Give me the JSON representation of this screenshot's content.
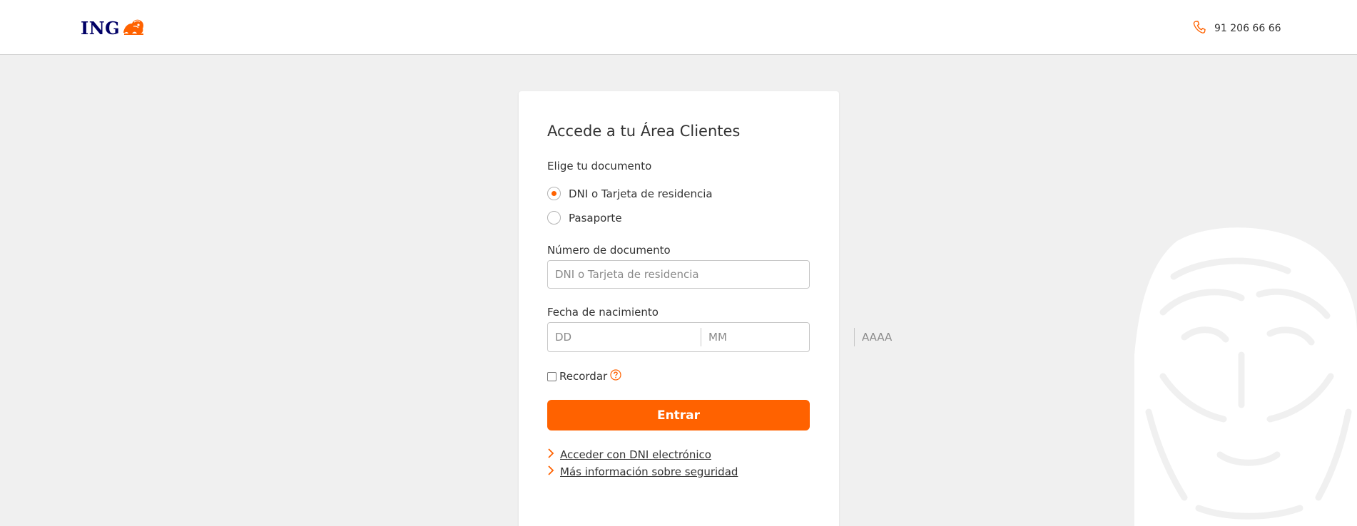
{
  "header": {
    "logo_text": "ING",
    "phone": "91 206 66 66"
  },
  "login": {
    "title": "Accede a tu Área Clientes",
    "doc_type_label": "Elige tu documento",
    "doc_options": [
      {
        "label": "DNI o Tarjeta de residencia",
        "selected": true
      },
      {
        "label": "Pasaporte",
        "selected": false
      }
    ],
    "doc_number_label": "Número de documento",
    "doc_number_placeholder": "DNI o Tarjeta de residencia",
    "birth_label": "Fecha de nacimiento",
    "day_placeholder": "DD",
    "month_placeholder": "MM",
    "year_placeholder": "AAAA",
    "remember_label": "Recordar",
    "submit_label": "Entrar",
    "links": [
      {
        "label": "Acceder con DNI electrónico"
      },
      {
        "label": "Más información sobre seguridad"
      }
    ]
  },
  "colors": {
    "brand_orange": "#ff6200",
    "brand_navy": "#000066",
    "background": "#f0f0f0"
  },
  "icons": {
    "logo": "lion-logo-icon",
    "phone": "phone-icon",
    "help": "help-icon",
    "link_chevron": "chevron-right-icon",
    "background": "lion-watermark-icon"
  }
}
